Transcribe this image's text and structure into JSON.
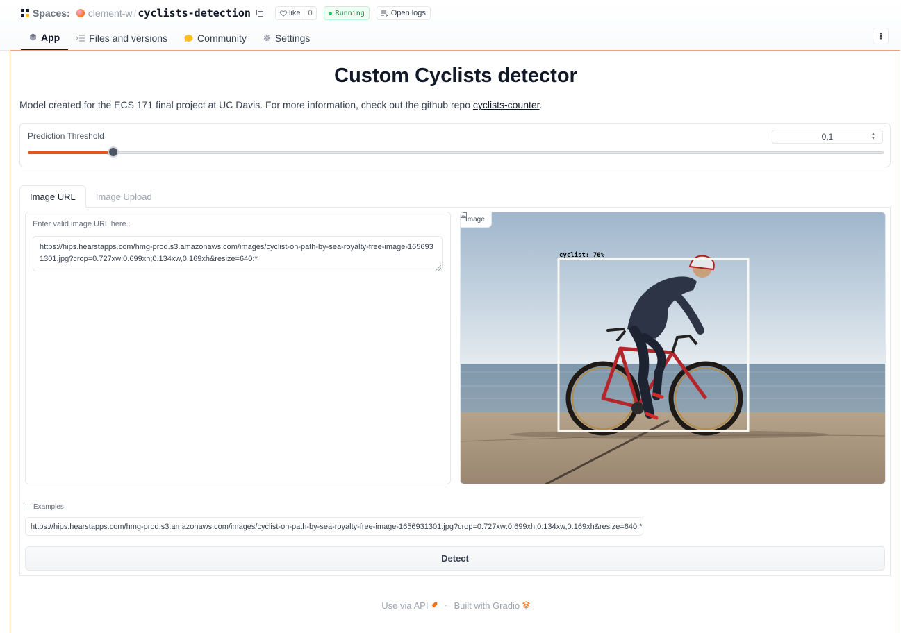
{
  "header": {
    "spaces_label": "Spaces:",
    "owner": "clement-w",
    "separator": "/",
    "repo": "cyclists-detection",
    "like_label": "like",
    "like_count": "0",
    "status": "Running",
    "logs_label": "Open logs",
    "tabs": [
      {
        "label": "App",
        "icon": "app-cube-icon",
        "active": true
      },
      {
        "label": "Files and versions",
        "icon": "files-icon",
        "active": false
      },
      {
        "label": "Community",
        "icon": "community-icon",
        "active": false
      },
      {
        "label": "Settings",
        "icon": "gear-icon",
        "active": false
      }
    ],
    "menu_glyph": "⋮"
  },
  "app": {
    "title": "Custom Cyclists detector",
    "description_prefix": "Model created for the ECS 171 final project at UC Davis. For more information, check out the github repo ",
    "description_link": "cyclists-counter",
    "description_suffix": ".",
    "threshold": {
      "label": "Prediction Threshold",
      "value_display": "0,1",
      "value": 0.1,
      "min": 0,
      "max": 1
    },
    "input_tabs": [
      {
        "label": "Image URL",
        "active": true
      },
      {
        "label": "Image Upload",
        "active": false
      }
    ],
    "url_input": {
      "placeholder": "Enter valid image URL here..",
      "value": "https://hips.hearstapps.com/hmg-prod.s3.amazonaws.com/images/cyclist-on-path-by-sea-royalty-free-image-1656931301.jpg?crop=0.727xw:0.699xh;0.134xw,0.169xh&resize=640:*"
    },
    "output_image": {
      "label": "Image",
      "detection_label": "cyclist: 76%"
    },
    "examples": {
      "label": "Examples",
      "items": [
        "https://hips.hearstapps.com/hmg-prod.s3.amazonaws.com/images/cyclist-on-path-by-sea-royalty-free-image-1656931301.jpg?crop=0.727xw:0.699xh;0.134xw,0.169xh&resize=640:*"
      ]
    },
    "detect_label": "Detect"
  },
  "footer": {
    "api_label": "Use via API",
    "separator": "·",
    "built_label": "Built with Gradio"
  },
  "colors": {
    "accent": "#e8541a",
    "running_green": "#15803d",
    "frame_border": "#f0a37a"
  }
}
